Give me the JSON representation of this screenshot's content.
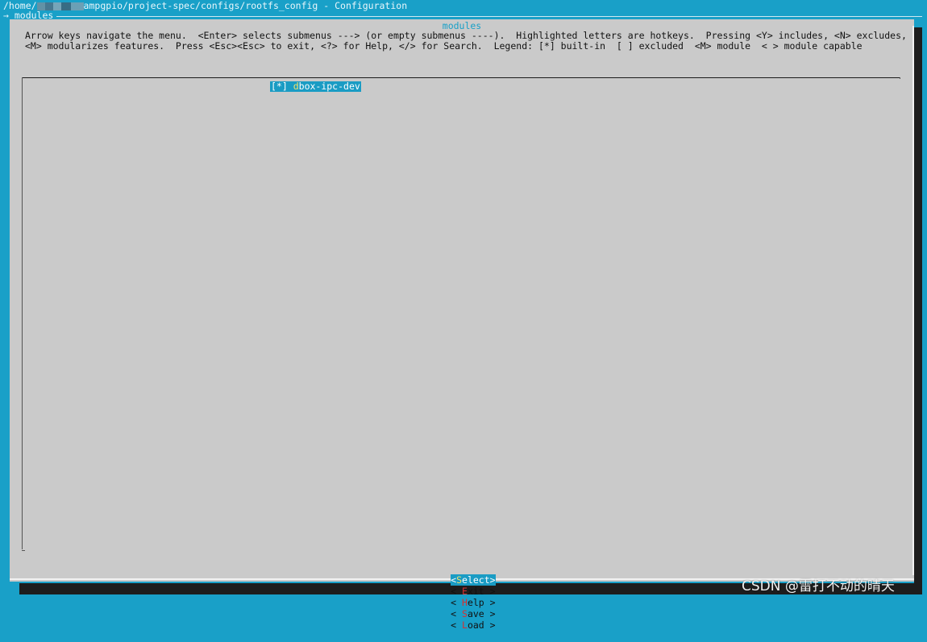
{
  "window": {
    "path_prefix": "/home/",
    "path_suffix": "ampgpio/project-spec/configs/rootfs_config - Configuration",
    "breadcrumb": "→ modules"
  },
  "dialog": {
    "title": "modules",
    "help_lines": [
      "Arrow keys navigate the menu.  <Enter> selects submenus ---> (or empty submenus ----).  Highlighted letters are hotkeys.  Pressing <Y> includes, <N> excludes,",
      "<M> modularizes features.  Press <Esc><Esc> to exit, <?> for Help, </> for Search.  Legend: [*] built-in  [ ] excluded  <M> module  < > module capable"
    ]
  },
  "menu": {
    "items": [
      {
        "prefix": "[*] ",
        "hotkey": "d",
        "rest": "box-ipc-dev",
        "selected": true
      }
    ]
  },
  "buttons": [
    {
      "pre": "<",
      "hot": "S",
      "post": "elect>",
      "selected": true
    },
    {
      "pre": "< ",
      "hot": "E",
      "post": "xit >",
      "selected": false
    },
    {
      "pre": "< ",
      "hot": "H",
      "post": "elp >",
      "selected": false
    },
    {
      "pre": "< ",
      "hot": "S",
      "post": "ave >",
      "selected": false
    },
    {
      "pre": "< ",
      "hot": "L",
      "post": "oad >",
      "selected": false
    }
  ],
  "watermark": "CSDN @雷打不动的晴天",
  "colors": {
    "terminal_bg": "#19a0c8",
    "dialog_bg": "#cacaca",
    "highlight": "#1a9cc4",
    "hotkey_item": "#f3e26b",
    "hotkey_button": "#d83030"
  }
}
